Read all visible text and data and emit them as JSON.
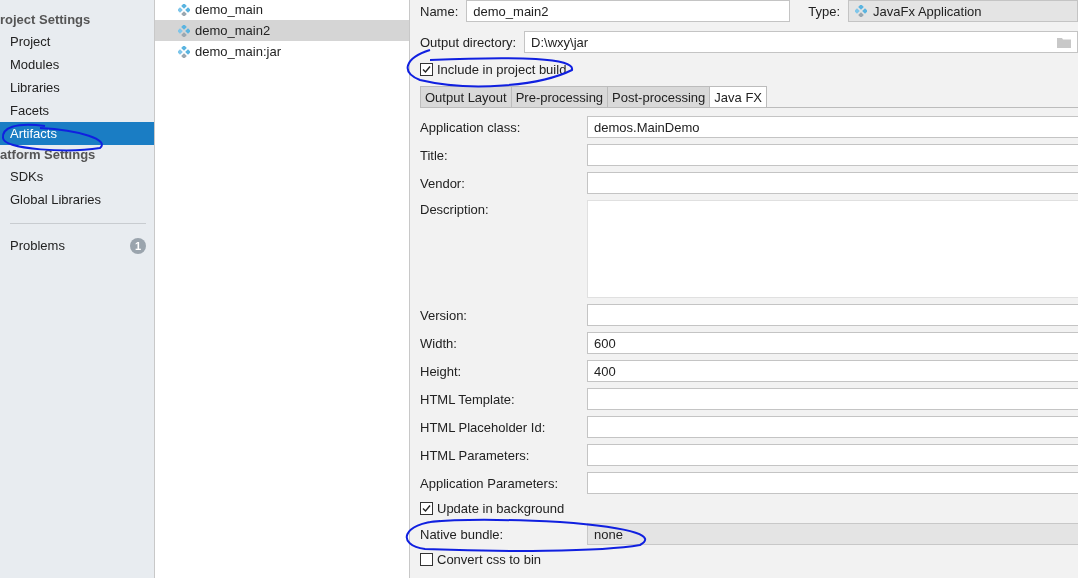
{
  "sidebar": {
    "groups": [
      {
        "title": "roject Settings",
        "items": [
          {
            "label": "Project",
            "selected": false
          },
          {
            "label": "Modules",
            "selected": false
          },
          {
            "label": "Libraries",
            "selected": false
          },
          {
            "label": "Facets",
            "selected": false
          },
          {
            "label": "Artifacts",
            "selected": true
          }
        ]
      },
      {
        "title": "atform Settings",
        "items": [
          {
            "label": "SDKs",
            "selected": false
          },
          {
            "label": "Global Libraries",
            "selected": false
          }
        ]
      }
    ],
    "problems": {
      "label": "Problems",
      "badge": "1"
    }
  },
  "artifacts": [
    {
      "name": "demo_main",
      "selected": false
    },
    {
      "name": "demo_main2",
      "selected": true
    },
    {
      "name": "demo_main:jar",
      "selected": false
    }
  ],
  "editor": {
    "name": {
      "label": "Name:",
      "value": "demo_main2"
    },
    "type": {
      "label": "Type:",
      "value": "JavaFx Application"
    },
    "output_directory": {
      "label": "Output directory:",
      "value": "D:\\wxy\\jar"
    },
    "include_in_build": {
      "label": "Include in project build",
      "checked": true
    },
    "tabs": [
      {
        "label": "Output Layout",
        "selected": false
      },
      {
        "label": "Pre-processing",
        "selected": false
      },
      {
        "label": "Post-processing",
        "selected": false
      },
      {
        "label": "Java FX",
        "selected": true
      }
    ],
    "form": [
      {
        "kind": "field",
        "label": "Application class:",
        "value": "demos.MainDemo"
      },
      {
        "kind": "field",
        "label": "Title:"
      },
      {
        "kind": "field",
        "label": "Vendor:"
      },
      {
        "kind": "textarea",
        "label": "Description:"
      },
      {
        "kind": "field",
        "label": "Version:"
      },
      {
        "kind": "field",
        "label": "Width:",
        "value": "600"
      },
      {
        "kind": "field",
        "label": "Height:",
        "value": "400"
      },
      {
        "kind": "field",
        "label": "HTML Template:"
      },
      {
        "kind": "field",
        "label": "HTML Placeholder Id:"
      },
      {
        "kind": "field",
        "label": "HTML Parameters:"
      },
      {
        "kind": "field",
        "label": "Application Parameters:"
      },
      {
        "kind": "checkbox",
        "label": "Update in background",
        "checked": true
      },
      {
        "kind": "select",
        "label": "Native bundle:",
        "value": "none"
      },
      {
        "kind": "checkbox",
        "label": "Convert css to bin",
        "checked": false
      }
    ]
  }
}
